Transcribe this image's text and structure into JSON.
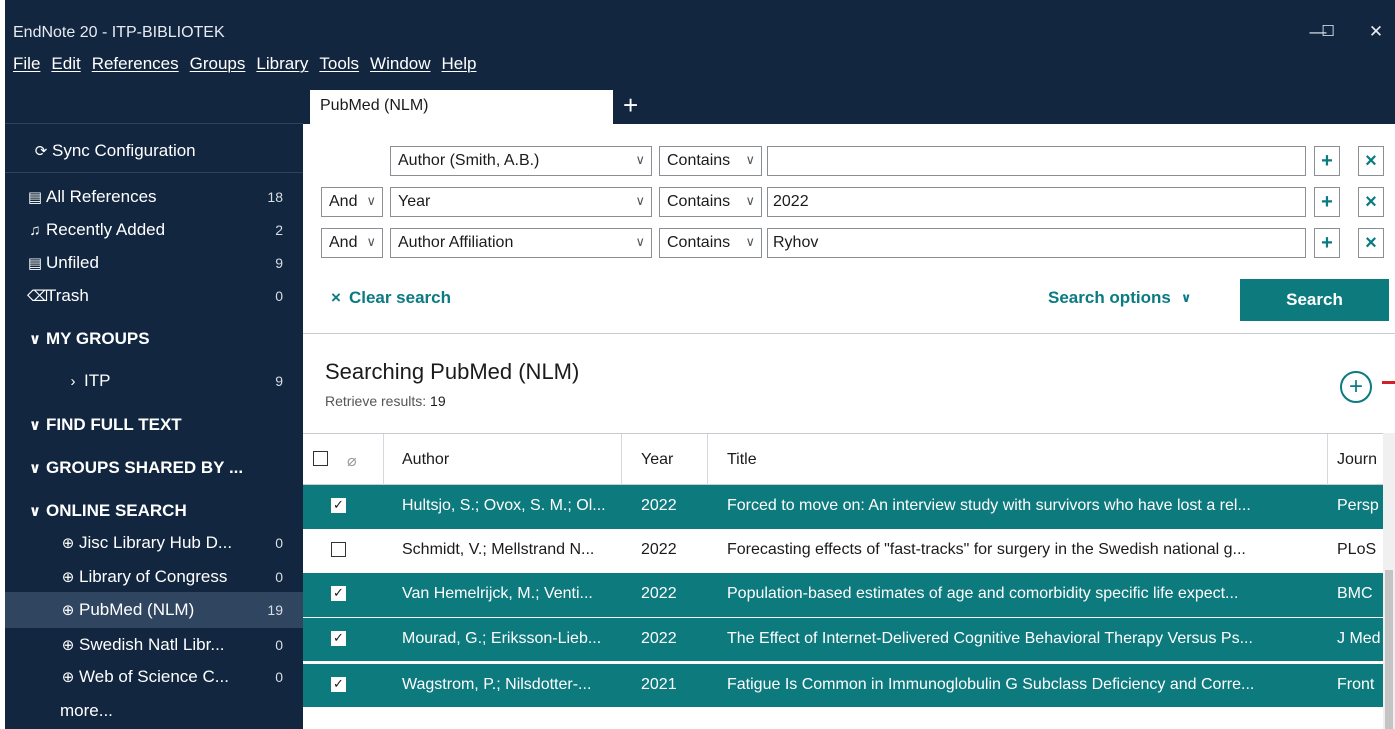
{
  "window": {
    "title": "EndNote 20 - ITP-BIBLIOTEK",
    "minimize": "—",
    "maximize": "☐",
    "close": "✕"
  },
  "menu": [
    "File",
    "Edit",
    "References",
    "Groups",
    "Library",
    "Tools",
    "Window",
    "Help"
  ],
  "sidebar": {
    "sync": "Sync Configuration",
    "library": [
      {
        "label": "All References",
        "count": "18",
        "icon": "references-icon"
      },
      {
        "label": "Recently Added",
        "count": "2",
        "icon": "bell-icon"
      },
      {
        "label": "Unfiled",
        "count": "9",
        "icon": "document-icon"
      },
      {
        "label": "Trash",
        "count": "0",
        "icon": "trash-icon"
      }
    ],
    "my_groups": "MY GROUPS",
    "group_itp": {
      "label": "ITP",
      "count": "9"
    },
    "find_full_text": "FIND FULL TEXT",
    "groups_shared": "GROUPS SHARED BY ...",
    "online_search": "ONLINE SEARCH",
    "online": [
      {
        "label": "Jisc Library Hub D...",
        "count": "0"
      },
      {
        "label": "Library of Congress",
        "count": "0"
      },
      {
        "label": "PubMed (NLM)",
        "count": "19"
      },
      {
        "label": "Swedish Natl Libr...",
        "count": "0"
      },
      {
        "label": "Web of Science C...",
        "count": "0"
      }
    ],
    "more": "more..."
  },
  "tabs": {
    "active": "PubMed (NLM)",
    "add": "+"
  },
  "search": {
    "rows": [
      {
        "bool": "",
        "field": "Author (Smith, A.B.)",
        "op": "Contains",
        "value": ""
      },
      {
        "bool": "And",
        "field": "Year",
        "op": "Contains",
        "value": "2022"
      },
      {
        "bool": "And",
        "field": "Author Affiliation",
        "op": "Contains",
        "value": "Ryhov"
      }
    ],
    "clear": "Clear search",
    "options": "Search options",
    "button": "Search"
  },
  "results": {
    "title": "Searching PubMed (NLM)",
    "retrieve_label": "Retrieve results:",
    "retrieve_count": "19"
  },
  "table": {
    "columns": [
      "Author",
      "Year",
      "Title",
      "Journ"
    ],
    "rows": [
      {
        "selected": true,
        "author": "Hultsjo, S.; Ovox, S. M.; Ol...",
        "year": "2022",
        "title": "Forced to move on: An interview study with survivors who have lost a rel...",
        "journal": "Persp"
      },
      {
        "selected": false,
        "author": "Schmidt, V.; Mellstrand N...",
        "year": "2022",
        "title": "Forecasting effects of \"fast-tracks\" for surgery in the Swedish national g...",
        "journal": "PLoS"
      },
      {
        "selected": true,
        "author": "Van Hemelrijck, M.; Venti...",
        "year": "2022",
        "title": "Population-based estimates of age and comorbidity specific life expect...",
        "journal": "BMC"
      },
      {
        "selected": true,
        "author": "Mourad, G.; Eriksson-Lieb...",
        "year": "2022",
        "title": "The Effect of Internet-Delivered Cognitive Behavioral Therapy Versus Ps...",
        "journal": "J Med"
      },
      {
        "selected": true,
        "author": "Wagstrom, P.; Nilsdotter-...",
        "year": "2021",
        "title": "Fatigue Is Common in Immunoglobulin G Subclass Deficiency and Corre...",
        "journal": "Front"
      }
    ]
  },
  "colors": {
    "navy": "#12263f",
    "teal": "#0d7a7e",
    "red": "#d0202a"
  }
}
